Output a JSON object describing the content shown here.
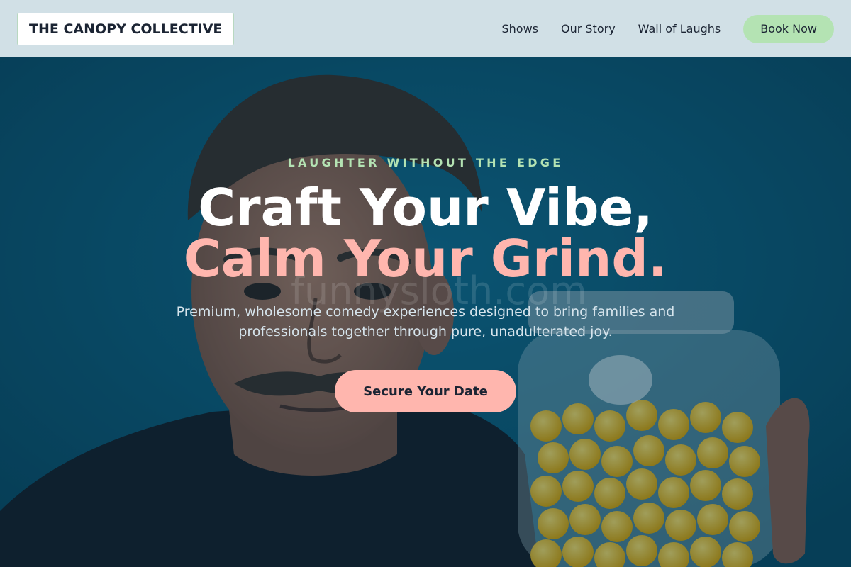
{
  "brand": {
    "name": "THE CANOPY COLLECTIVE"
  },
  "nav": {
    "links": [
      {
        "label": "Shows"
      },
      {
        "label": "Our Story"
      },
      {
        "label": "Wall of Laughs"
      }
    ],
    "cta_label": "Book Now"
  },
  "hero": {
    "eyebrow": "LAUGHTER WITHOUT THE EDGE",
    "headline_line1": "Craft Your Vibe,",
    "headline_line2": "Calm Your Grind.",
    "subtext": "Premium, wholesome comedy experiences designed to bring families and professionals together through pure, unadulterated joy.",
    "cta_label": "Secure Your Date",
    "watermark": "funnysloth.com"
  },
  "colors": {
    "nav_bg": "#d1e0e6",
    "accent_green": "#b4e3b3",
    "accent_pink": "#ffb6ae",
    "hero_blue": "#0c5a78",
    "text_dark": "#1b2433"
  }
}
